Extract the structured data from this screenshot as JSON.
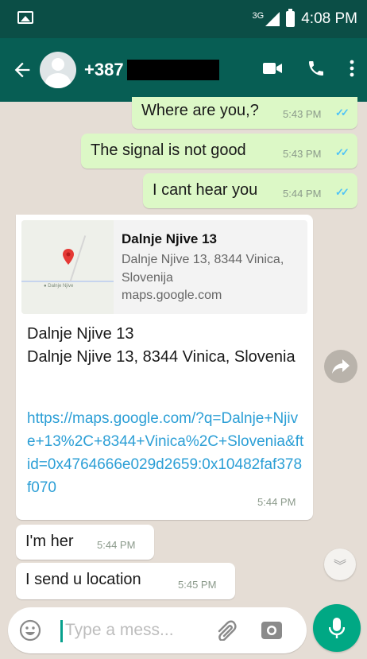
{
  "status_bar": {
    "network": "3G",
    "time": "4:08 PM"
  },
  "header": {
    "contact_number": "+387",
    "accent_color": "#075e54"
  },
  "messages": [
    {
      "direction": "outgoing",
      "text": "Where are you,?",
      "time": "5:43 PM",
      "status": "read"
    },
    {
      "direction": "outgoing",
      "text": "The signal is not good",
      "time": "5:43 PM",
      "status": "read"
    },
    {
      "direction": "outgoing",
      "text": "I cant hear you",
      "time": "5:44 PM",
      "status": "read"
    },
    {
      "direction": "incoming",
      "preview": {
        "title": "Dalnje Njive 13",
        "subtitle": "Dalnje Njive 13, 8344 Vinica, Slovenija",
        "domain": "maps.google.com"
      },
      "text_line1": "Dalnje Njive 13",
      "text_line2": "Dalnje Njive 13, 8344 Vinica, Slovenia",
      "link": "https://maps.google.com/?q=Dalnje+Njive+13%2C+8344+Vinica%2C+Slovenia&ftid=0x4764666e029d2659:0x10482faf378f070",
      "time": "5:44 PM"
    },
    {
      "direction": "incoming",
      "text": "I'm her",
      "time": "5:44 PM"
    },
    {
      "direction": "incoming",
      "text": "I send u location",
      "time": "5:45 PM"
    }
  ],
  "composer": {
    "placeholder": "Type a mess..."
  },
  "icons": {
    "status": [
      "gallery-icon",
      "signal-icon",
      "battery-icon"
    ],
    "header": [
      "back-arrow-icon",
      "video-call-icon",
      "phone-icon",
      "more-options-icon"
    ],
    "composer": [
      "emoji-icon",
      "attach-icon",
      "camera-icon",
      "mic-icon"
    ]
  },
  "colors": {
    "outgoing_bubble": "#dcf8c6",
    "read_ticks": "#4fc3f7",
    "link": "#2c9fd6",
    "mic_button": "#00a884"
  }
}
